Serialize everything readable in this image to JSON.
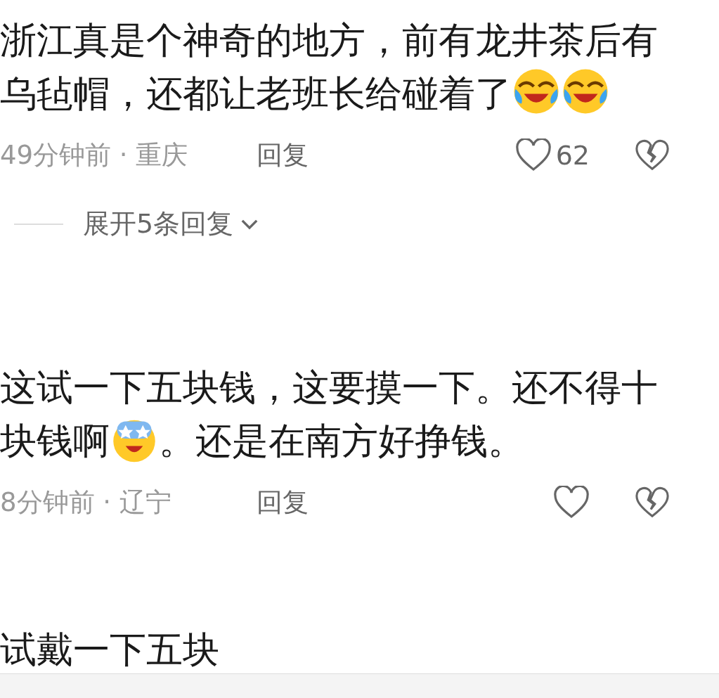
{
  "comments": [
    {
      "segments": [
        {
          "kind": "text",
          "text": "浙江真是个神奇的地方，前有龙井茶后有乌毡帽，还都让老班长给碰着了"
        },
        {
          "kind": "laugh"
        },
        {
          "kind": "laugh"
        }
      ],
      "meta": "49分钟前 · 重庆",
      "reply": "回复",
      "likes": "62",
      "expand": "展开5条回复"
    },
    {
      "segments": [
        {
          "kind": "text",
          "text": "这试一下五块钱，这要摸一下。还不得十块钱啊"
        },
        {
          "kind": "stars"
        },
        {
          "kind": "text",
          "text": "。还是在南方好挣钱。"
        }
      ],
      "meta": "8分钟前 · 辽宁",
      "reply": "回复"
    },
    {
      "segments": [
        {
          "kind": "text",
          "text": "试戴一下五块"
        }
      ]
    }
  ]
}
